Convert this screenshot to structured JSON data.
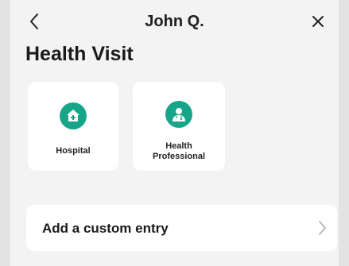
{
  "header": {
    "title": "John Q.",
    "back_icon": "chevron-left-icon",
    "close_icon": "close-icon"
  },
  "page": {
    "title": "Health Visit"
  },
  "cards": [
    {
      "label": "Hospital",
      "icon": "hospital-icon"
    },
    {
      "label": "Health\nProfessional",
      "icon": "doctor-icon"
    }
  ],
  "custom_entry": {
    "label": "Add a custom entry",
    "icon": "chevron-right-icon"
  },
  "colors": {
    "accent": "#17a58a",
    "background": "#f3f3f3",
    "card": "#ffffff"
  }
}
